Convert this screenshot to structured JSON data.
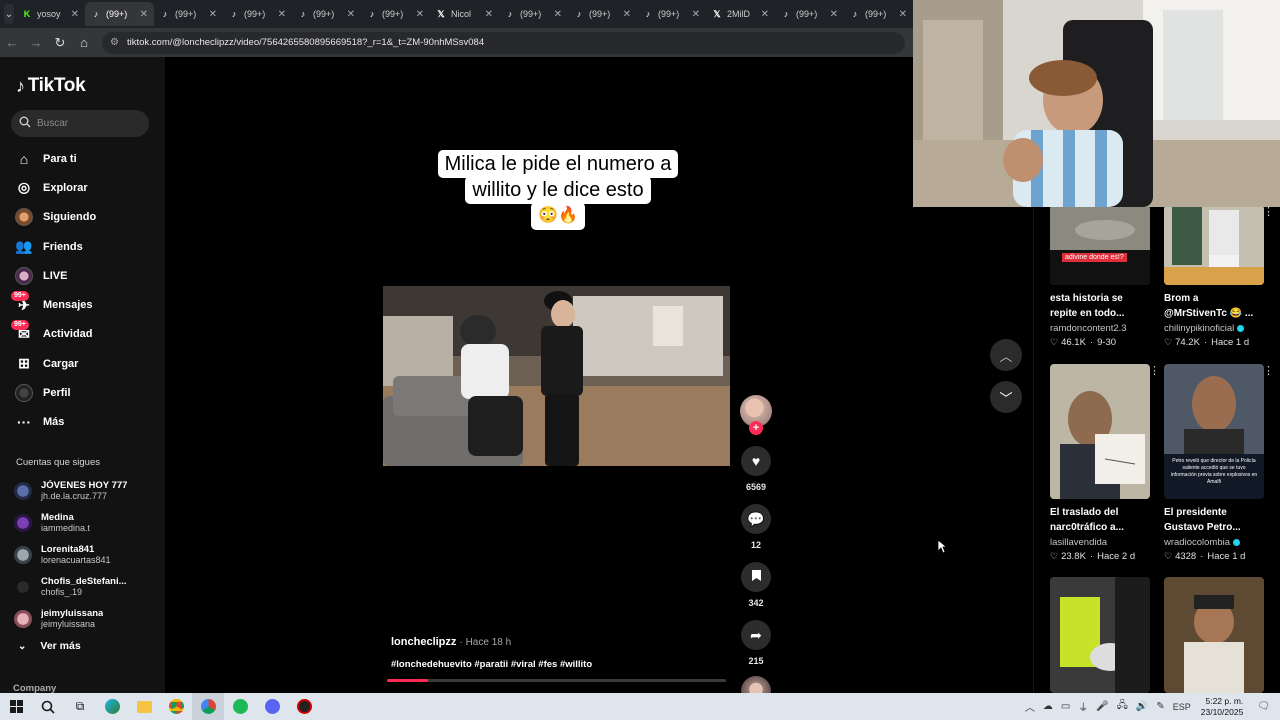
{
  "browser": {
    "tabs": [
      {
        "label": "yosoy",
        "icon": "kick-icon",
        "active": false
      },
      {
        "label": "(99+)",
        "icon": "tiktok-icon",
        "active": true
      },
      {
        "label": "(99+)",
        "icon": "tiktok-icon",
        "active": false
      },
      {
        "label": "(99+)",
        "icon": "tiktok-icon",
        "active": false
      },
      {
        "label": "(99+)",
        "icon": "tiktok-icon",
        "active": false
      },
      {
        "label": "(99+)",
        "icon": "tiktok-icon",
        "active": false
      },
      {
        "label": "Nicol",
        "icon": "x-icon",
        "active": false
      },
      {
        "label": "(99+)",
        "icon": "tiktok-icon",
        "active": false
      },
      {
        "label": "(99+)",
        "icon": "tiktok-icon",
        "active": false
      },
      {
        "label": "(99+)",
        "icon": "tiktok-icon",
        "active": false
      },
      {
        "label": "2MilD",
        "icon": "x-icon",
        "active": false
      },
      {
        "label": "(99+)",
        "icon": "tiktok-icon",
        "active": false
      },
      {
        "label": "(99+)",
        "icon": "tiktok-icon",
        "active": false
      }
    ],
    "url": "tiktok.com/@loncheclipzz/video/7564265580895669518?_r=1&_t=ZM-90nhMSsv084"
  },
  "sidebar": {
    "logo": "TikTok",
    "search_placeholder": "Buscar",
    "nav": [
      {
        "label": "Para ti",
        "icon": "home-icon",
        "badge": ""
      },
      {
        "label": "Explorar",
        "icon": "compass-icon",
        "badge": ""
      },
      {
        "label": "Siguiendo",
        "icon": "avatar-icon",
        "badge": ""
      },
      {
        "label": "Friends",
        "icon": "friends-icon",
        "badge": ""
      },
      {
        "label": "LIVE",
        "icon": "live-avatar-icon",
        "badge": ""
      },
      {
        "label": "Mensajes",
        "icon": "message-icon",
        "badge": "99+"
      },
      {
        "label": "Actividad",
        "icon": "activity-icon",
        "badge": "99+"
      },
      {
        "label": "Cargar",
        "icon": "upload-icon",
        "badge": ""
      },
      {
        "label": "Perfil",
        "icon": "profile-avatar-icon",
        "badge": ""
      },
      {
        "label": "Más",
        "icon": "more-icon",
        "badge": ""
      }
    ],
    "following_title": "Cuentas que sigues",
    "following": [
      {
        "name": "JÓVENES HOY 777",
        "user": "jh.de.la.cruz.777"
      },
      {
        "name": "Medina",
        "user": "iammedina.t"
      },
      {
        "name": "Lorenita841",
        "user": "lorenacuartas841"
      },
      {
        "name": "Chofis_deStefani...",
        "user": "chofis_.19"
      },
      {
        "name": "jeimyluissana",
        "user": "jeimyluissana"
      }
    ],
    "see_more": "Ver más",
    "company": "Company"
  },
  "video": {
    "overlay_lines": [
      "Milica le pide el numero a",
      "willito y le dice esto",
      "😳🔥"
    ],
    "likes": "6569",
    "comments": "12",
    "saves": "342",
    "shares": "215",
    "author": "loncheclipzz",
    "posted": "· Hace 18 h",
    "hashtags": "#lonchedehuevito #paratii #viral #fes #willito",
    "progress": 0.12
  },
  "grid": [
    {
      "title": "esta historia se repite en todo...",
      "author": "ramdoncontent2.3",
      "verified": false,
      "likes": "46.1K",
      "date": "9-30",
      "overlay": "adivine donde es!?"
    },
    {
      "title": "Brom a @MrStivenTc 😂 ...",
      "author": "chilinypikinoficial",
      "verified": true,
      "likes": "74.2K",
      "date": "Hace 1 d",
      "overlay": ""
    },
    {
      "title": "El traslado del narc0tráfico a...",
      "author": "lasillavendida",
      "verified": false,
      "likes": "23.8K",
      "date": "Hace 2 d",
      "overlay": ""
    },
    {
      "title": "El presidente Gustavo Petro...",
      "author": "wradiocolombia",
      "verified": true,
      "likes": "4328",
      "date": "Hace 1 d",
      "overlay": "Petro reveló que director de la Policía saliente accedió que se tuvo información previa sobre explosivos en Amalfi"
    },
    {
      "title": "",
      "author": "",
      "verified": false,
      "likes": "",
      "date": "",
      "overlay": ""
    },
    {
      "title": "",
      "author": "",
      "verified": false,
      "likes": "",
      "date": "",
      "overlay": ""
    }
  ],
  "taskbar": {
    "language": "ESP",
    "time": "5:22 p. m.",
    "date": "23/10/2025"
  }
}
